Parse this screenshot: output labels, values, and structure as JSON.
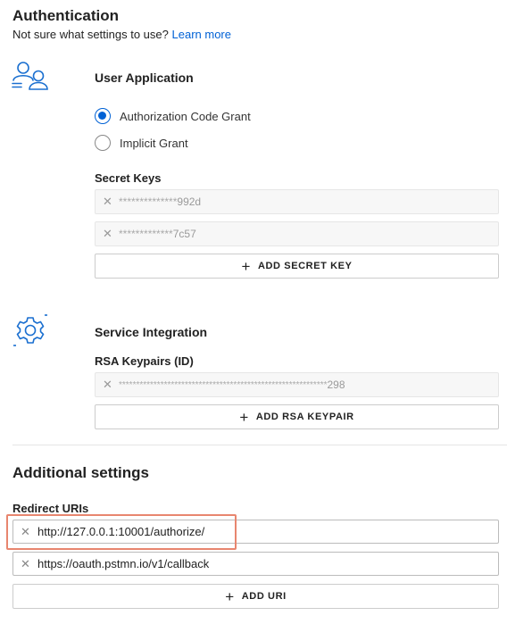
{
  "authentication": {
    "title": "Authentication",
    "subtitle": "Not sure what settings to use?",
    "learn_more": "Learn more"
  },
  "user_application": {
    "icon": "users-icon",
    "title": "User Application",
    "grant_options": [
      {
        "label": "Authorization Code Grant",
        "selected": true
      },
      {
        "label": "Implicit Grant",
        "selected": false
      }
    ],
    "secret_keys_label": "Secret Keys",
    "secret_keys": [
      {
        "mask": "**************",
        "suffix": "992d"
      },
      {
        "mask": "*************",
        "suffix": "7c57"
      }
    ],
    "add_secret_key": "ADD SECRET KEY"
  },
  "service_integration": {
    "icon": "gear-icon",
    "title": "Service Integration",
    "rsa_label": "RSA Keypairs (ID)",
    "rsa_keypairs": [
      {
        "mask": "************************************************************",
        "suffix": "298"
      }
    ],
    "add_rsa_keypair": "ADD RSA KEYPAIR"
  },
  "additional_settings": {
    "title": "Additional settings",
    "redirect_label": "Redirect URIs",
    "redirect_uris": [
      "http://127.0.0.1:10001/authorize/",
      "https://oauth.pstmn.io/v1/callback"
    ],
    "add_uri": "ADD URI"
  },
  "colors": {
    "accent": "#0061d5",
    "icon": "#1a6fd0",
    "highlight": "#e8866f"
  }
}
